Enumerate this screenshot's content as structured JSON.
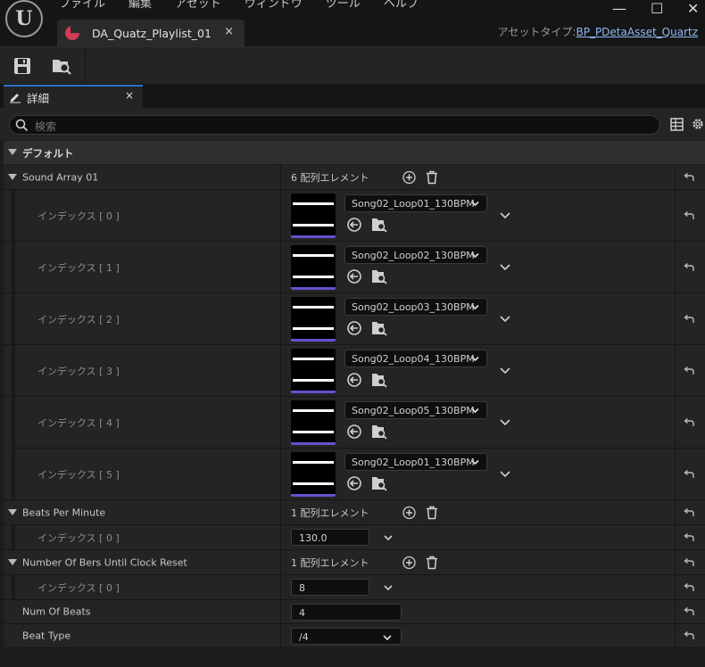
{
  "menu": [
    "ファイル",
    "編集",
    "アセット",
    "ウィンドウ",
    "ツール",
    "ヘルプ"
  ],
  "window_controls": {
    "minimize": "—",
    "maximize": "☐",
    "close": "✕"
  },
  "document_tab": {
    "name": "DA_Quatz_Playlist_01",
    "close": "×"
  },
  "asset_type": {
    "label": "アセットタイプ:",
    "value": "BP_PDetaAsset_Quartz"
  },
  "details_tab": {
    "label": "詳細",
    "close": "×"
  },
  "search": {
    "placeholder": "検索"
  },
  "category": {
    "label": "デフォルト"
  },
  "sound_array": {
    "label": "Sound Array 01",
    "count": "6 配列エレメント",
    "items": [
      {
        "index": "インデックス [ 0 ]",
        "asset": "Song02_Loop01_130BPM"
      },
      {
        "index": "インデックス [ 1 ]",
        "asset": "Song02_Loop02_130BPM"
      },
      {
        "index": "インデックス [ 2 ]",
        "asset": "Song02_Loop03_130BPM"
      },
      {
        "index": "インデックス [ 3 ]",
        "asset": "Song02_Loop04_130BPM"
      },
      {
        "index": "インデックス [ 4 ]",
        "asset": "Song02_Loop05_130BPM"
      },
      {
        "index": "インデックス [ 5 ]",
        "asset": "Song02_Loop01_130BPM"
      }
    ]
  },
  "bpm": {
    "label": "Beats Per Minute",
    "count": "1 配列エレメント",
    "index": "インデックス [ 0 ]",
    "value": "130.0"
  },
  "bars_reset": {
    "label": "Number Of Bers Until Clock Reset",
    "count": "1 配列エレメント",
    "index": "インデックス [ 0 ]",
    "value": "8"
  },
  "num_beats": {
    "label": "Num Of Beats",
    "value": "4"
  },
  "beat_type": {
    "label": "Beat Type",
    "value": "/4"
  },
  "colors": {
    "accent_tab": "#2e70c8",
    "asset_thumb_bar": "#6a4fcf",
    "asset_link": "#8eb8f2",
    "doc_icon": "#d23a57"
  }
}
